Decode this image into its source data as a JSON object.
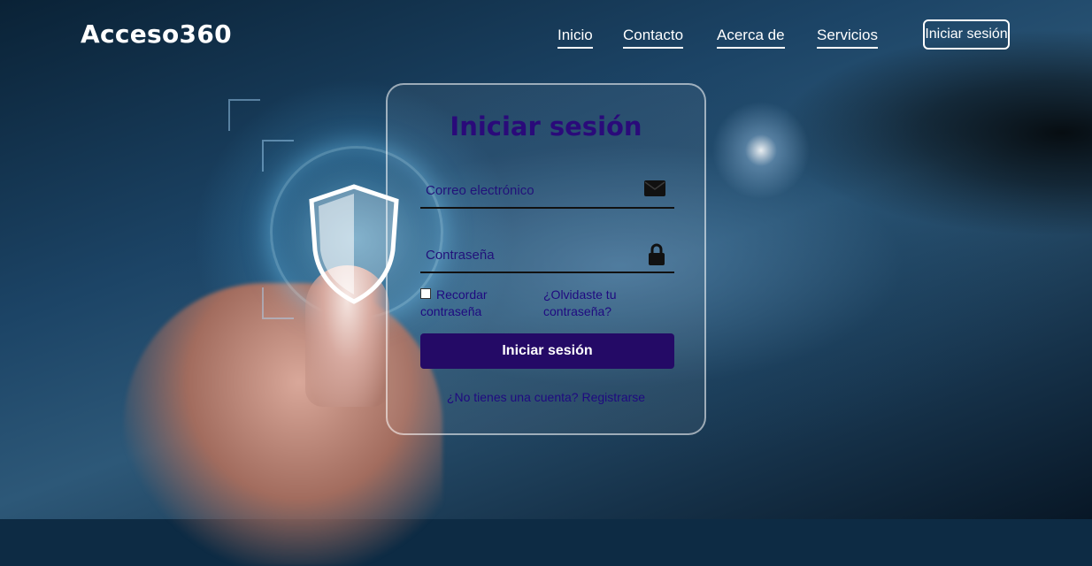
{
  "brand": {
    "logo_text": "Acceso360"
  },
  "nav": {
    "items": [
      {
        "label": "Inicio"
      },
      {
        "label": "Contacto"
      },
      {
        "label": "Acerca de"
      },
      {
        "label": "Servicios"
      }
    ],
    "login_button": "Iniciar sesión"
  },
  "login_form": {
    "title": "Iniciar sesión",
    "email": {
      "placeholder": "Correo electrónico",
      "value": "",
      "icon": "envelope-icon"
    },
    "password": {
      "placeholder": "Contraseña",
      "value": "",
      "icon": "lock-icon"
    },
    "remember_label": "Recordar contraseña",
    "remember_checked": false,
    "forgot_link": "¿Olvidaste tu contraseña?",
    "submit_label": "Iniciar sesión",
    "register_prompt": "¿No tienes una cuenta?",
    "register_link": "Registrarse"
  },
  "colors": {
    "title": "#2a0a7a",
    "submit_bg": "#240a66",
    "text_dark": "#1f0a80",
    "nav_text": "#ffffff"
  }
}
